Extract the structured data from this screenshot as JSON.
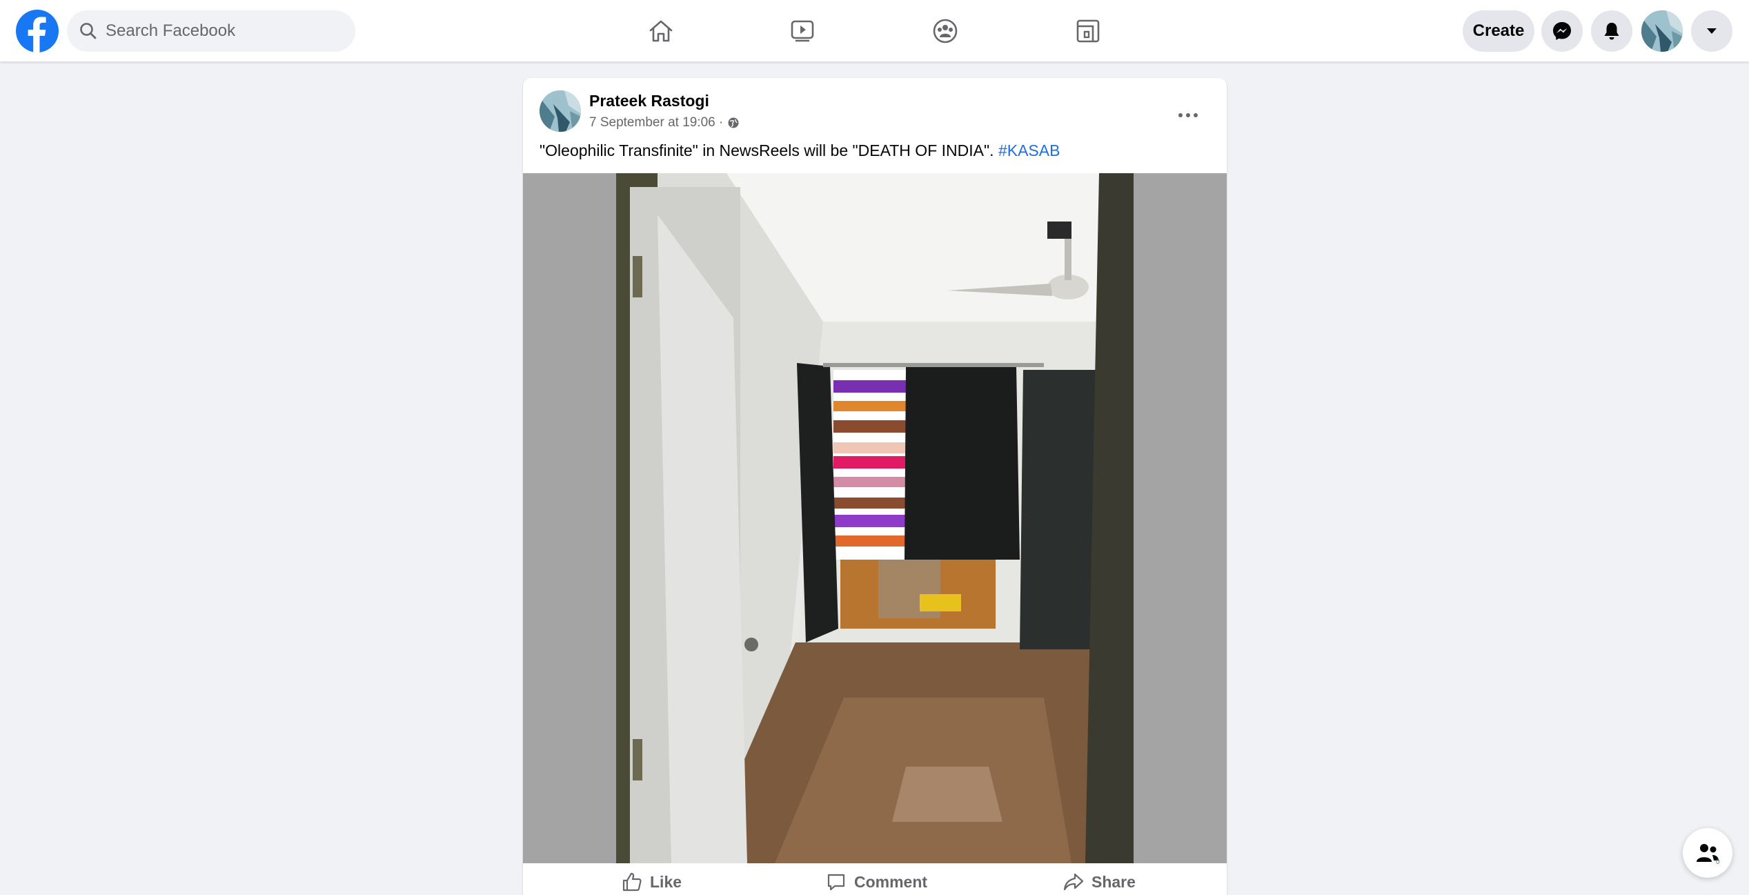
{
  "header": {
    "logo_icon": "facebook-logo-icon",
    "search": {
      "placeholder": "Search Facebook",
      "icon": "search-icon"
    },
    "nav_tabs": [
      {
        "name": "home",
        "icon": "home-icon"
      },
      {
        "name": "watch",
        "icon": "video-play-icon"
      },
      {
        "name": "groups",
        "icon": "groups-icon"
      },
      {
        "name": "gaming",
        "icon": "gaming-icon"
      }
    ],
    "create_label": "Create",
    "messenger_icon": "messenger-icon",
    "notifications_icon": "bell-icon",
    "account_menu_icon": "caret-down-icon"
  },
  "post": {
    "author": "Prateek Rastogi",
    "timestamp": "7 September at 19:06 ·",
    "audience_icon": "globe-icon",
    "text": "\"Oleophilic Transfinite\" in NewsReels will be \"DEATH OF INDIA\". ",
    "hashtag": "#KASAB",
    "photo": "room-doorway-photo",
    "actions": {
      "like": "Like",
      "comment": "Comment",
      "share": "Share"
    }
  },
  "contacts_fab": {
    "icon": "contacts-icon",
    "count": "0"
  },
  "colors": {
    "brand": "#1877f2",
    "background": "#f0f2f5",
    "link": "#216fdb",
    "secondary_text": "#65676b"
  }
}
